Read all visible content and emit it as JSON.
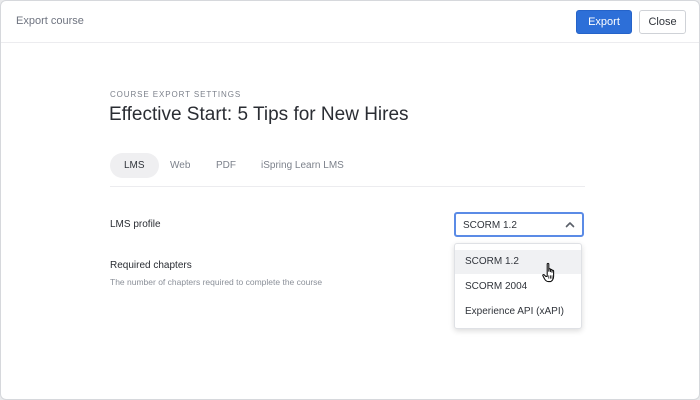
{
  "window": {
    "title": "Export course"
  },
  "toolbar": {
    "export_label": "Export",
    "close_label": "Close"
  },
  "settings": {
    "overline": "COURSE EXPORT SETTINGS",
    "course_title": "Effective Start: 5 Tips for New Hires"
  },
  "tabs": [
    {
      "label": "LMS",
      "active": true
    },
    {
      "label": "Web",
      "active": false
    },
    {
      "label": "PDF",
      "active": false
    },
    {
      "label": "iSpring Learn LMS",
      "active": false
    }
  ],
  "lms_profile": {
    "label": "LMS profile",
    "selected": "SCORM 1.2",
    "expanded": true,
    "options": [
      "SCORM 1.2",
      "SCORM 2004",
      "Experience API (xAPI)"
    ],
    "hovered_option": "SCORM 1.2"
  },
  "required_chapters": {
    "label": "Required chapters",
    "help": "The number of chapters required to complete the course"
  },
  "colors": {
    "accent": "#2d6fd8",
    "focus_border": "#5b8be6"
  },
  "icons": {
    "select_chevron": "chevron-up-icon",
    "pointer": "hand-pointer-icon"
  }
}
